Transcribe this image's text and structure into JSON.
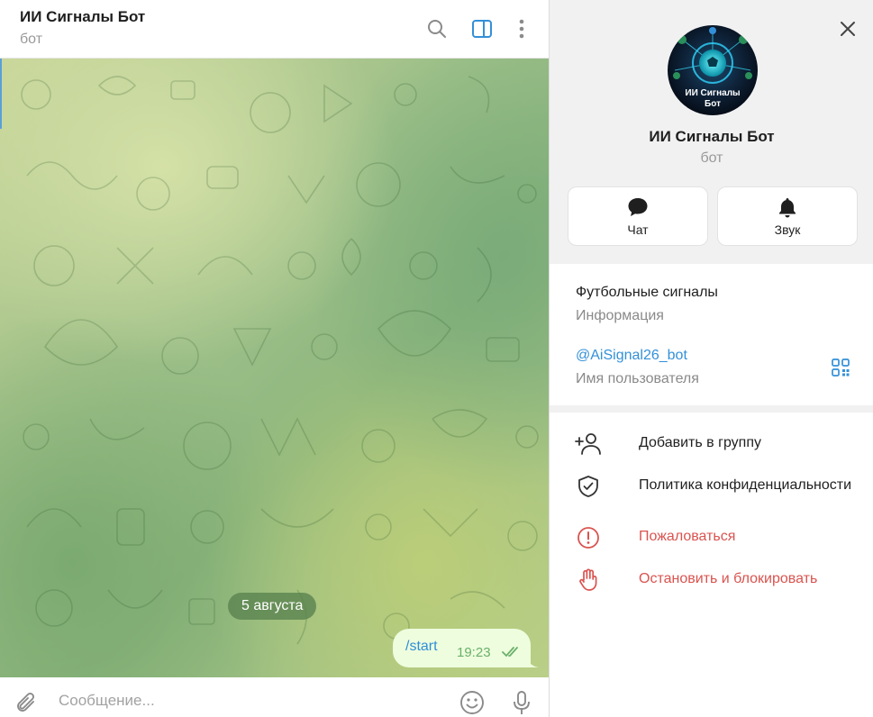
{
  "chat": {
    "title": "ИИ Сигналы Бот",
    "subtitle": "бот",
    "date_separator": "5 августа",
    "messages": [
      {
        "text": "/start",
        "time": "19:23",
        "status": "read"
      }
    ],
    "composer": {
      "placeholder": "Сообщение..."
    }
  },
  "info_panel": {
    "name": "ИИ Сигналы Бот",
    "status": "бот",
    "avatar": {
      "caption_line1": "ИИ Сигналы",
      "caption_line2": "Бот"
    },
    "action_buttons": [
      {
        "label": "Чат",
        "icon": "chat-bubble-icon"
      },
      {
        "label": "Звук",
        "icon": "bell-icon"
      }
    ],
    "about": {
      "value": "Футбольные сигналы",
      "label": "Информация"
    },
    "username": {
      "value": "@AiSignal26_bot",
      "label": "Имя пользователя"
    },
    "menu": [
      {
        "label": "Добавить в группу",
        "icon": "add-user-icon",
        "danger": false
      },
      {
        "label": "Политика конфиденциальности",
        "icon": "shield-check-icon",
        "danger": false
      },
      {
        "label": "Пожаловаться",
        "icon": "report-icon",
        "danger": true
      },
      {
        "label": "Остановить и блокировать",
        "icon": "block-hand-icon",
        "danger": true
      }
    ]
  },
  "colors": {
    "accent": "#3390d8",
    "danger": "#d9534f",
    "outgoing_bubble": "#eefdde",
    "read_check": "#6bb06b"
  }
}
